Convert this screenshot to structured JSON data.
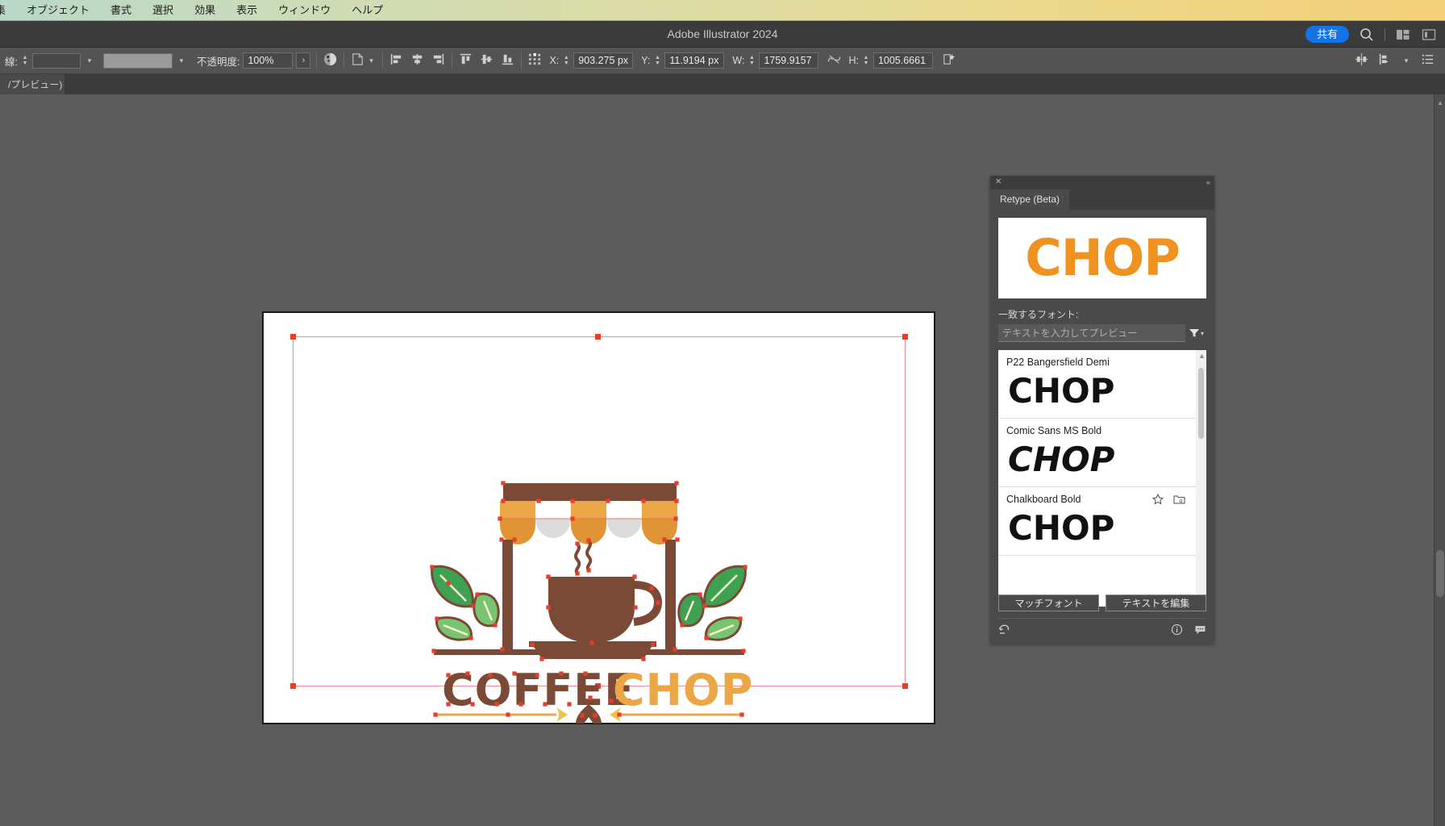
{
  "menubar": {
    "items": [
      {
        "label": "集",
        "name": "menu-edit-truncated"
      },
      {
        "label": "オブジェクト",
        "name": "menu-object"
      },
      {
        "label": "書式",
        "name": "menu-type"
      },
      {
        "label": "選択",
        "name": "menu-select"
      },
      {
        "label": "効果",
        "name": "menu-effect"
      },
      {
        "label": "表示",
        "name": "menu-view"
      },
      {
        "label": "ウィンドウ",
        "name": "menu-window"
      },
      {
        "label": "ヘルプ",
        "name": "menu-help"
      }
    ]
  },
  "titlebar": {
    "title": "Adobe Illustrator 2024",
    "share_label": "共有",
    "share_color": "#1473e6",
    "icons": [
      "search-icon",
      "arrange-documents-icon",
      "workspace-switcher-icon"
    ]
  },
  "controlbar": {
    "stroke_label": "線:",
    "stroke_weight_value": "",
    "stroke_profile_value": "",
    "opacity_label": "不透明度:",
    "opacity_value": "100%",
    "x_label": "X:",
    "x_value": "903.275 px",
    "y_label": "Y:",
    "y_value": "11.9194 px",
    "w_label": "W:",
    "w_value": "1759.9157",
    "h_label": "H:",
    "h_value": "1005.6661",
    "icons": [
      "opacity-mask-icon",
      "transform-icon",
      "align-left-icon",
      "align-center-horizontal-icon",
      "align-right-icon",
      "align-top-icon",
      "align-middle-vertical-icon",
      "align-bottom-icon",
      "distribute-top-icon",
      "distribute-center-icon",
      "distribute-bottom-icon",
      "reference-point-icon",
      "constrain-proportions-icon",
      "transform-effects-icon",
      "transform-panel-icon",
      "align-panel-icon",
      "properties-list-icon"
    ]
  },
  "tabbar": {
    "doc_tab_label": "/プレビュー)"
  },
  "canvas": {
    "artboard_background": "#ffffff",
    "selection_stroke": "#f08b8b",
    "anchor_color": "#ea3c2a"
  },
  "logo": {
    "title_dark_text": "COFFEE",
    "title_accent_text": "CHOP",
    "colors": {
      "brown": "#7b4a36",
      "orange": "#eba646",
      "orange_dark": "#e09434",
      "green": "#3fa152",
      "green_light": "#79c46f",
      "awning_white": "#dcdcdc",
      "accent": "#eba646"
    }
  },
  "panel": {
    "tab_label": "Retype (Beta)",
    "close_icon": "close-icon",
    "collapse_icon": "collapse-panel-icon",
    "preview_text": "CHOP",
    "preview_color": "#f0921f",
    "match_label": "一致するフォント:",
    "search_placeholder": "テキストを入力してプレビュー",
    "filter_icon": "filter-icon",
    "fonts": [
      {
        "name": "P22 Bangersfield Demi",
        "sample": "CHOP",
        "style": "plain",
        "show_actions": false
      },
      {
        "name": "Comic Sans MS Bold",
        "sample": "CHOP",
        "style": "comic",
        "show_actions": false
      },
      {
        "name": "Chalkboard Bold",
        "sample": "CHOP",
        "style": "plain",
        "show_actions": true
      }
    ],
    "row_action_icons": [
      "favorite-star-icon",
      "activate-font-icon"
    ],
    "buttons": {
      "match_font": "マッチフォント",
      "edit_text": "テキストを編集"
    },
    "footer_icons": [
      "reset-icon",
      "info-icon",
      "feedback-icon"
    ]
  },
  "scrollbar": {
    "vertical_thumb_name": "vertical-scroll-thumb"
  }
}
